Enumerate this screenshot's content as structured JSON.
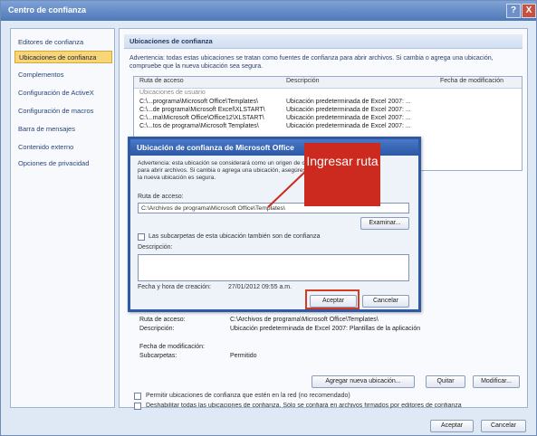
{
  "window": {
    "title": "Centro de confianza",
    "help": "?",
    "close": "X"
  },
  "sidebar": {
    "items": [
      {
        "label": "Editores de confianza"
      },
      {
        "label": "Ubicaciones de confianza"
      },
      {
        "label": "Complementos"
      },
      {
        "label": "Configuración de ActiveX"
      },
      {
        "label": "Configuración de macros"
      },
      {
        "label": "Barra de mensajes"
      },
      {
        "label": "Contenido externo"
      },
      {
        "label": "Opciones de privacidad"
      }
    ]
  },
  "main": {
    "header": "Ubicaciones de confianza",
    "warning": "Advertencia: todas estas ubicaciones se tratan como fuentes de confianza para abrir archivos. Si cambia o agrega una ubicación, compruebe que la nueva ubicación sea segura.",
    "table": {
      "columns": [
        "Ruta de acceso",
        "Descripción",
        "Fecha de modificación"
      ],
      "group": "Ubicaciones de usuario",
      "rows": [
        {
          "path": "C:\\...programa\\Microsoft Office\\Templates\\",
          "desc": "Ubicación predeterminada de Excel 2007: ..."
        },
        {
          "path": "C:\\...de programa\\Microsoft Excel\\XLSTART\\",
          "desc": "Ubicación predeterminada de Excel 2007: ..."
        },
        {
          "path": "C:\\...ma\\Microsoft Office\\Office12\\XLSTART\\",
          "desc": "Ubicación predeterminada de Excel 2007: ..."
        },
        {
          "path": "C:\\...tos de programa\\Microsoft Templates\\",
          "desc": "Ubicación predeterminada de Excel 2007: ..."
        }
      ]
    },
    "details": {
      "path_label": "Ruta de acceso:",
      "path_value": "C:\\Archivos de programa\\Microsoft Office\\Templates\\",
      "desc_label": "Descripción:",
      "desc_value": "Ubicación predeterminada de Excel 2007: Plantillas de la aplicación",
      "date_label": "Fecha de modificación:",
      "date_value": "",
      "sub_label": "Subcarpetas:",
      "sub_value": "Permitido"
    },
    "buttons": {
      "add": "Agregar nueva ubicación...",
      "remove": "Quitar",
      "modify": "Modificar..."
    },
    "check_network": "Permitir ubicaciones de confianza que estén en la red (no recomendado)",
    "check_disable": "Deshabilitar todas las ubicaciones de confianza. Sólo se confiará en archivos firmados por editores de confianza"
  },
  "footer": {
    "ok": "Aceptar",
    "cancel": "Cancelar"
  },
  "dialog": {
    "title": "Ubicación de confianza de Microsoft Office",
    "text": "Advertencia: esta ubicación se considerará como un origen de confianza para abrir archivos. Si cambia o agrega una ubicación, asegúrese de que la nueva ubicación es segura.",
    "path_label": "Ruta de acceso:",
    "path_value": "C:\\Archivos de programa\\Microsoft Office\\Templates\\",
    "browse": "Examinar...",
    "subfolders": "Las subcarpetas de esta ubicación también son de confianza",
    "desc_label": "Descripción:",
    "date_label": "Fecha y hora de creación:",
    "date_value": "27/01/2012 09:55 a.m.",
    "ok": "Aceptar",
    "cancel": "Cancelar"
  },
  "callout": {
    "text": "Ingresar ruta",
    "color": "#cc2a1f"
  }
}
